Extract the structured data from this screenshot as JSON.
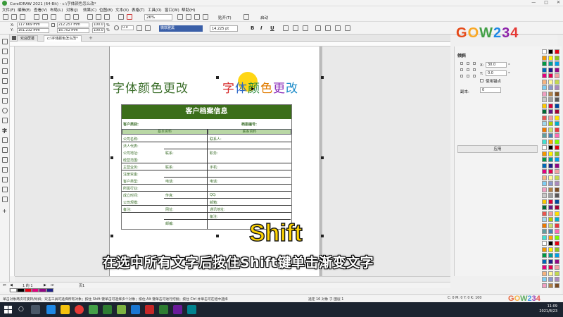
{
  "window": {
    "title": "CorelDRAW 2021 (64-Bit) - c:\\字体颜色怎么改*"
  },
  "menu": [
    "文件(F)",
    "编辑(E)",
    "查看(V)",
    "布局(L)",
    "对象(J)",
    "效果(C)",
    "位图(B)",
    "文本(X)",
    "表格(T)",
    "工具(O)",
    "窗口(W)",
    "帮助(H)"
  ],
  "toolbar": {
    "zoom": "26%",
    "snap": "贴齐(T)",
    "launch": "启动"
  },
  "propbar": {
    "x": "117.669 mm",
    "y": "161.232 mm",
    "w": "212.257 mm",
    "h": "16.752 mm",
    "sx": "100.0",
    "sy": "100.0",
    "unit": "%",
    "angle": "0.0",
    "font": "微软雅黑",
    "size": "14.225 pt"
  },
  "tabs": {
    "welcome": "欢迎屏幕",
    "doc": "c:\\字体颜色怎么改*"
  },
  "document": {
    "headline_left": "字体颜色更改",
    "headline_right_chars": [
      "字",
      "体",
      "颜",
      "色",
      "更",
      "改"
    ],
    "headline_right_colors": [
      "#d62828",
      "#2a66c8",
      "#2a8a3a",
      "#e07b00",
      "#8a2ab8",
      "#1a8ac8"
    ],
    "table_title": "客户档案信息",
    "left_heading": "客户类别:",
    "right_heading": "档案编号:",
    "left_sub": "基本资料",
    "right_sub": "联系资料",
    "left_cells": [
      "公司名称:",
      "法人代表:",
      "公司地址:",
      "经营范围:",
      "主营业务:",
      "注册资金:",
      "客户类型:",
      "所属行业:",
      "成立时间:",
      "公司规模:",
      "备注:"
    ],
    "left_cells_mid": [
      "联系:",
      "联系:",
      "电话:",
      "传真:",
      "网址:",
      "邮编:"
    ],
    "right_cells": [
      "联系人:",
      "职务:",
      "手机:",
      "电话:",
      "QQ:",
      "邮箱:",
      "通讯地址:",
      "备注:"
    ],
    "overlay_key": "Shift",
    "subtitle": "在选中所有文字后按住Shift键单击渐变文字"
  },
  "pagetabs": {
    "page_counter": "1 的 1",
    "page_name": "页1"
  },
  "statusbar": {
    "hint": "单击对象两次可旋转/倾斜；双击工具可选择所有对象；按住 Shift 键单击可选择多个对象；按住 Alt 键单击可进行挖掘；按住 Ctrl 并单击可在组中选择",
    "selection": "选定 16 对象 于 图层 1",
    "coords": "C: 0 M: 0 Y: 0 K: 100"
  },
  "docker": {
    "title": "倾斜",
    "x_label": "X:",
    "x_value": "30.0",
    "y_label": "Y:",
    "y_value": "0.0",
    "anchor_label": "使用锚点",
    "copies_label": "副本:",
    "copies_value": "0",
    "apply": "应用"
  },
  "logo": {
    "text": "GOW234",
    "colors": [
      "#e64a19",
      "#f9a825",
      "#43a047",
      "#1e88e5",
      "#8e24aa",
      "#e53935"
    ]
  },
  "taskbar": {
    "time": "11:09",
    "date": "2021/8/23"
  },
  "swatch_colors": [
    "#ffffff",
    "#000000",
    "#e60012",
    "#f39800",
    "#fff100",
    "#8fc31f",
    "#009944",
    "#009e96",
    "#00a0e9",
    "#0068b7",
    "#1d2088",
    "#920783",
    "#e4007f",
    "#e5004f",
    "#f2a0a1",
    "#f6b37f",
    "#fff799",
    "#c3d94e",
    "#7ecef4",
    "#8c97cb",
    "#aa89bd",
    "#f19ec2",
    "#b28247",
    "#7d4e24",
    "#c9c9c9",
    "#9e9e9e",
    "#595757",
    "#fcc800",
    "#d7003a",
    "#00479d",
    "#006934",
    "#601986",
    "#a40035",
    "#ea5550",
    "#f29c9f",
    "#ffe100",
    "#a0d8ef",
    "#b5d100",
    "#00afcc",
    "#ee7800",
    "#c7dc68",
    "#e8383d",
    "#5f9ea0",
    "#4682b4",
    "#ff69b4",
    "#40e0d0",
    "#ffa500",
    "#7cfc00"
  ]
}
